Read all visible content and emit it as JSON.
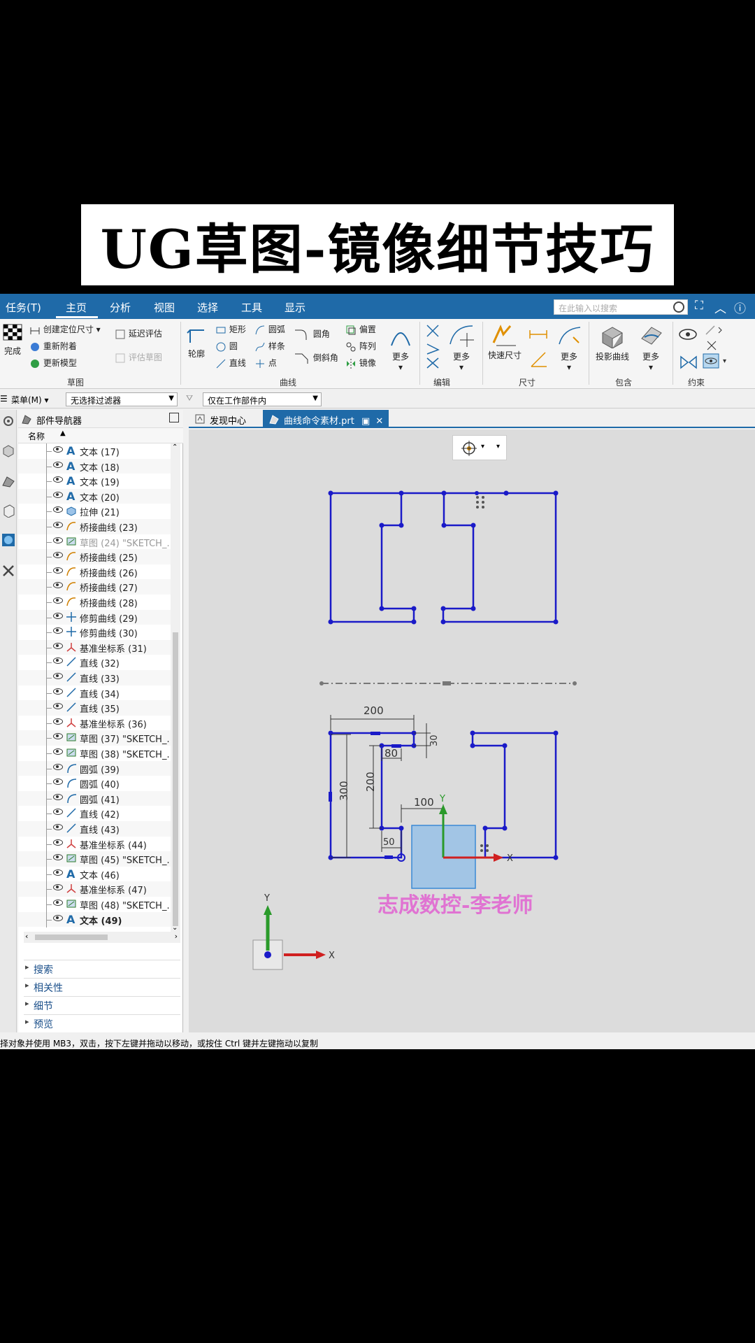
{
  "banner": {
    "title": "UG草图-镜像细节技巧"
  },
  "menubar": {
    "items": [
      "任务(T)",
      "主页",
      "分析",
      "视图",
      "选择",
      "工具",
      "显示"
    ],
    "search_placeholder": "在此输入以搜索"
  },
  "ribbon": {
    "done": "完成",
    "create_dim": "创建定位尺寸",
    "reattach": "重新附着",
    "update_model": "更新模型",
    "delay_eval": "延迟评估",
    "eval_sketch": "评估草图",
    "group_sketch": "草图",
    "profile": "轮廓",
    "rect": "矩形",
    "arc": "圆弧",
    "circle": "圆",
    "spline": "样条",
    "line": "直线",
    "point": "点",
    "fillet": "圆角",
    "chamfer": "倒斜角",
    "offset": "偏置",
    "array": "阵列",
    "mirror": "镜像",
    "more": "更多",
    "group_curve": "曲线",
    "group_edit": "编辑",
    "rapid_dim": "快速尺寸",
    "group_dim": "尺寸",
    "project_curve": "投影曲线",
    "group_include": "包含",
    "group_constraint": "约束"
  },
  "filterbar": {
    "menu": "菜单(M)",
    "filter": "无选择过滤器",
    "scope": "仅在工作部件内"
  },
  "navigator": {
    "title": "部件导航器",
    "col_name": "名称",
    "items": [
      {
        "label": "文本 (17)",
        "icon": "text-icon"
      },
      {
        "label": "文本 (18)",
        "icon": "text-icon"
      },
      {
        "label": "文本 (19)",
        "icon": "text-icon"
      },
      {
        "label": "文本 (20)",
        "icon": "text-icon"
      },
      {
        "label": "拉伸 (21)",
        "icon": "extrude-icon"
      },
      {
        "label": "桥接曲线 (23)",
        "icon": "curve-icon"
      },
      {
        "label": "草图 (24) \"SKETCH_...",
        "icon": "sketch-icon"
      },
      {
        "label": "桥接曲线 (25)",
        "icon": "curve-icon"
      },
      {
        "label": "桥接曲线 (26)",
        "icon": "curve-icon"
      },
      {
        "label": "桥接曲线 (27)",
        "icon": "curve-icon"
      },
      {
        "label": "桥接曲线 (28)",
        "icon": "curve-icon"
      },
      {
        "label": "修剪曲线 (29)",
        "icon": "trim-icon"
      },
      {
        "label": "修剪曲线 (30)",
        "icon": "trim-icon"
      },
      {
        "label": "基准坐标系 (31)",
        "icon": "csys-icon"
      },
      {
        "label": "直线 (32)",
        "icon": "line-icon"
      },
      {
        "label": "直线 (33)",
        "icon": "line-icon"
      },
      {
        "label": "直线 (34)",
        "icon": "line-icon"
      },
      {
        "label": "直线 (35)",
        "icon": "line-icon"
      },
      {
        "label": "基准坐标系 (36)",
        "icon": "csys-icon"
      },
      {
        "label": "草图 (37) \"SKETCH_...",
        "icon": "sketch-icon"
      },
      {
        "label": "草图 (38) \"SKETCH_...",
        "icon": "sketch-icon"
      },
      {
        "label": "圆弧 (39)",
        "icon": "arc-icon"
      },
      {
        "label": "圆弧 (40)",
        "icon": "arc-icon"
      },
      {
        "label": "圆弧 (41)",
        "icon": "arc-icon"
      },
      {
        "label": "直线 (42)",
        "icon": "line-icon"
      },
      {
        "label": "直线 (43)",
        "icon": "line-icon"
      },
      {
        "label": "基准坐标系 (44)",
        "icon": "csys-icon"
      },
      {
        "label": "草图 (45) \"SKETCH_...",
        "icon": "sketch-icon"
      },
      {
        "label": "文本 (46)",
        "icon": "text-icon"
      },
      {
        "label": "基准坐标系 (47)",
        "icon": "csys-icon"
      },
      {
        "label": "草图 (48) \"SKETCH_...",
        "icon": "sketch-icon"
      },
      {
        "label": "文本 (49)",
        "icon": "text-icon"
      }
    ],
    "sections": [
      "搜索",
      "相关性",
      "细节",
      "预览"
    ]
  },
  "tabs": {
    "discover": "发现中心",
    "file": "曲线命令素材.prt"
  },
  "canvas": {
    "dims": [
      "200",
      "30",
      "80",
      "300",
      "200",
      "100",
      "50"
    ],
    "watermark": "志成数控-李老师",
    "axis_x": "X",
    "axis_y": "Y"
  },
  "statusbar": {
    "text": "择对象并使用 MB3，双击，按下左键并拖动以移动，或按住 Ctrl 键并左键拖动以复制"
  },
  "colors": {
    "accent": "#1f6aa8",
    "sketch": "#1a1ac8",
    "axis_y": "#2a9a2a",
    "axis_x": "#d02020",
    "watermark": "#e060d0"
  }
}
